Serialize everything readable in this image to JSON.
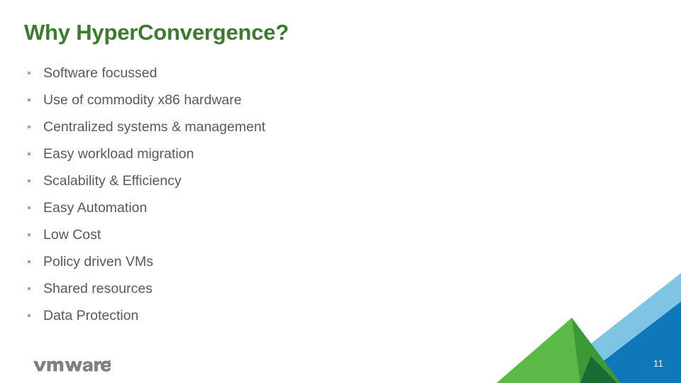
{
  "slide": {
    "title": "Why HyperConvergence?",
    "title_color": "#3c7a2e",
    "background_color": "#ffffff",
    "page_number": "11"
  },
  "bullets": [
    {
      "text": "Software focussed"
    },
    {
      "text": "Use of commodity x86 hardware"
    },
    {
      "text": "Centralized systems & management"
    },
    {
      "text": "Easy workload migration"
    },
    {
      "text": "Scalability & Efficiency"
    },
    {
      "text": "Easy Automation"
    },
    {
      "text": "Low Cost"
    },
    {
      "text": "Policy driven VMs"
    },
    {
      "text": "Shared resources"
    },
    {
      "text": "Data Protection"
    }
  ],
  "bullet_style": {
    "text_color": "#595959",
    "marker_color": "#a6a6a6",
    "marker_icon": "square-bullet-icon"
  },
  "logo": {
    "name": "vmware-logo",
    "wordmark": "vmware",
    "color": "#808080"
  },
  "decoration": {
    "name": "corner-triangles-graphic",
    "colors": {
      "light_blue": "#7fc5e3",
      "dark_blue": "#0f78b8",
      "light_green": "#5bb948",
      "medium_green": "#3c9a36",
      "dark_green": "#1a6b33"
    }
  }
}
